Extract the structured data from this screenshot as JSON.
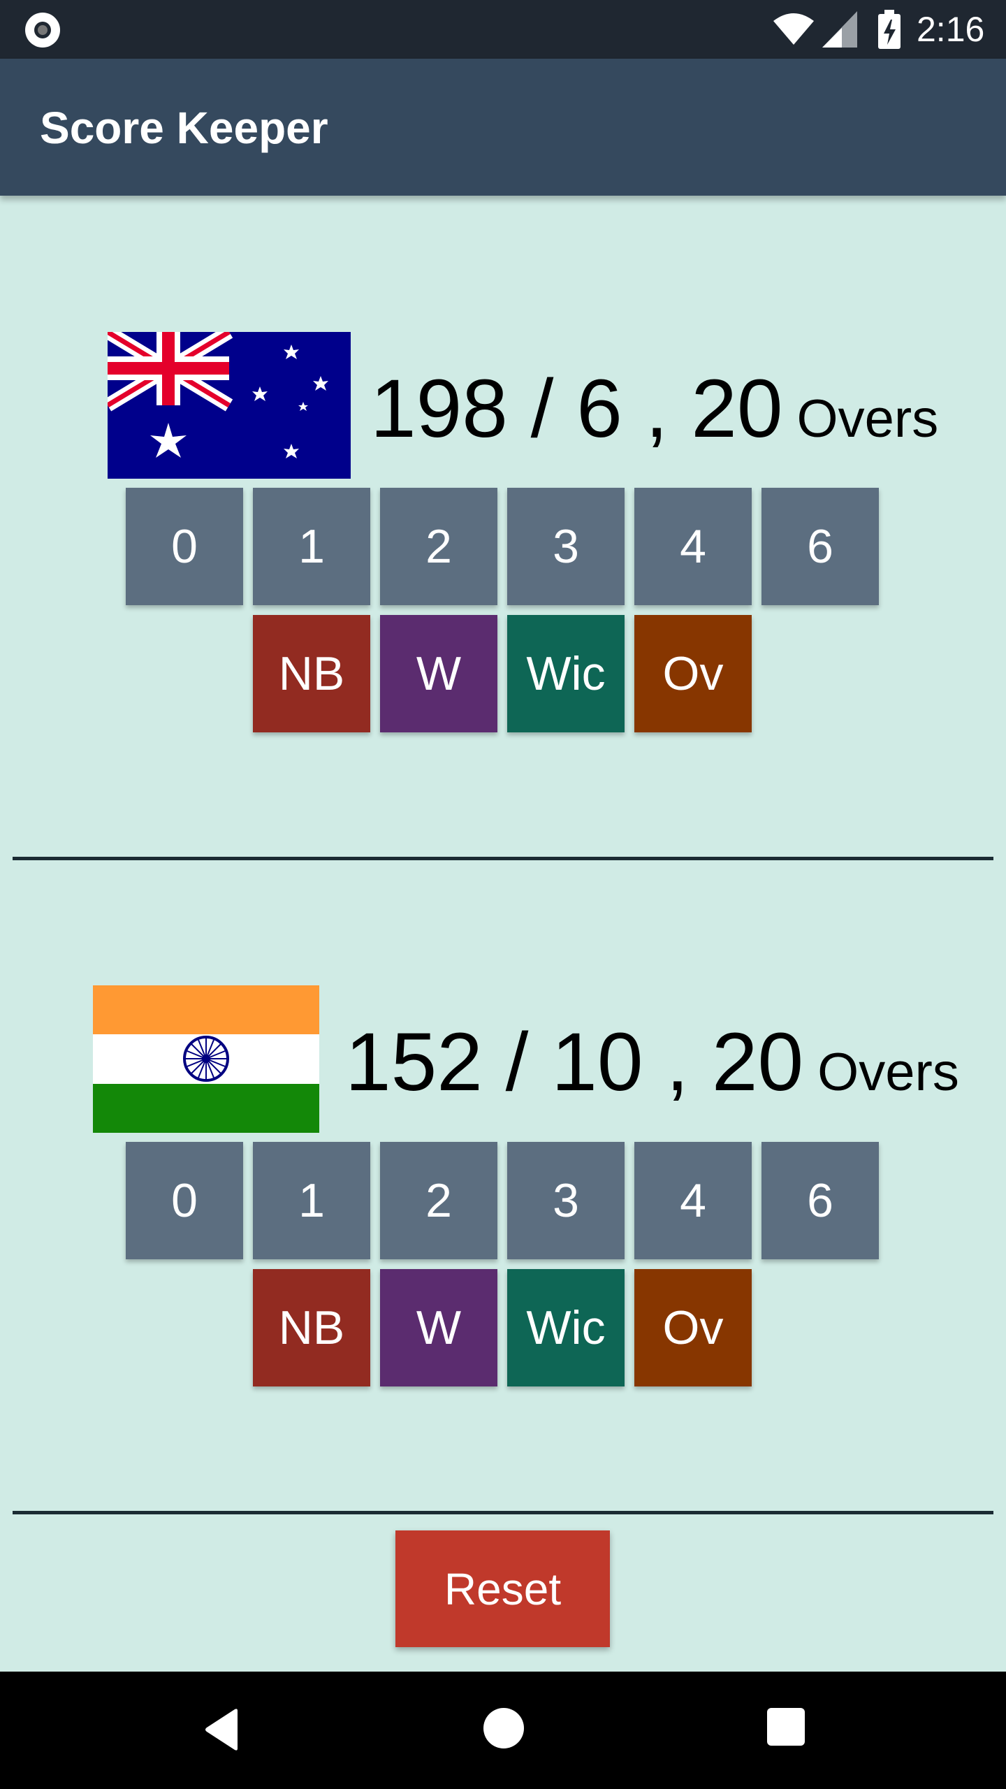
{
  "status_bar": {
    "time": "2:16"
  },
  "app": {
    "title": "Score Keeper"
  },
  "teams": [
    {
      "flag": "australia-flag",
      "runs": "198",
      "wickets": "6",
      "overs": "20",
      "overs_label": "Overs",
      "run_buttons": [
        "0",
        "1",
        "2",
        "3",
        "4",
        "6"
      ],
      "extra_buttons": [
        {
          "label": "NB",
          "color": "#922b21"
        },
        {
          "label": "W",
          "color": "#5b2c6f"
        },
        {
          "label": "Wic",
          "color": "#0e6655"
        },
        {
          "label": "Ov",
          "color": "#873600"
        }
      ]
    },
    {
      "flag": "india-flag",
      "runs": "152",
      "wickets": "10",
      "overs": "20",
      "overs_label": "Overs",
      "run_buttons": [
        "0",
        "1",
        "2",
        "3",
        "4",
        "6"
      ],
      "extra_buttons": [
        {
          "label": "NB",
          "color": "#922b21"
        },
        {
          "label": "W",
          "color": "#5b2c6f"
        },
        {
          "label": "Wic",
          "color": "#0e6655"
        },
        {
          "label": "Ov",
          "color": "#873600"
        }
      ]
    }
  ],
  "reset_label": "Reset",
  "colors": {
    "app_bar": "#35495e",
    "background": "#d0ebe5",
    "run_button": "#5c6e80",
    "reset": "#c0392b"
  }
}
